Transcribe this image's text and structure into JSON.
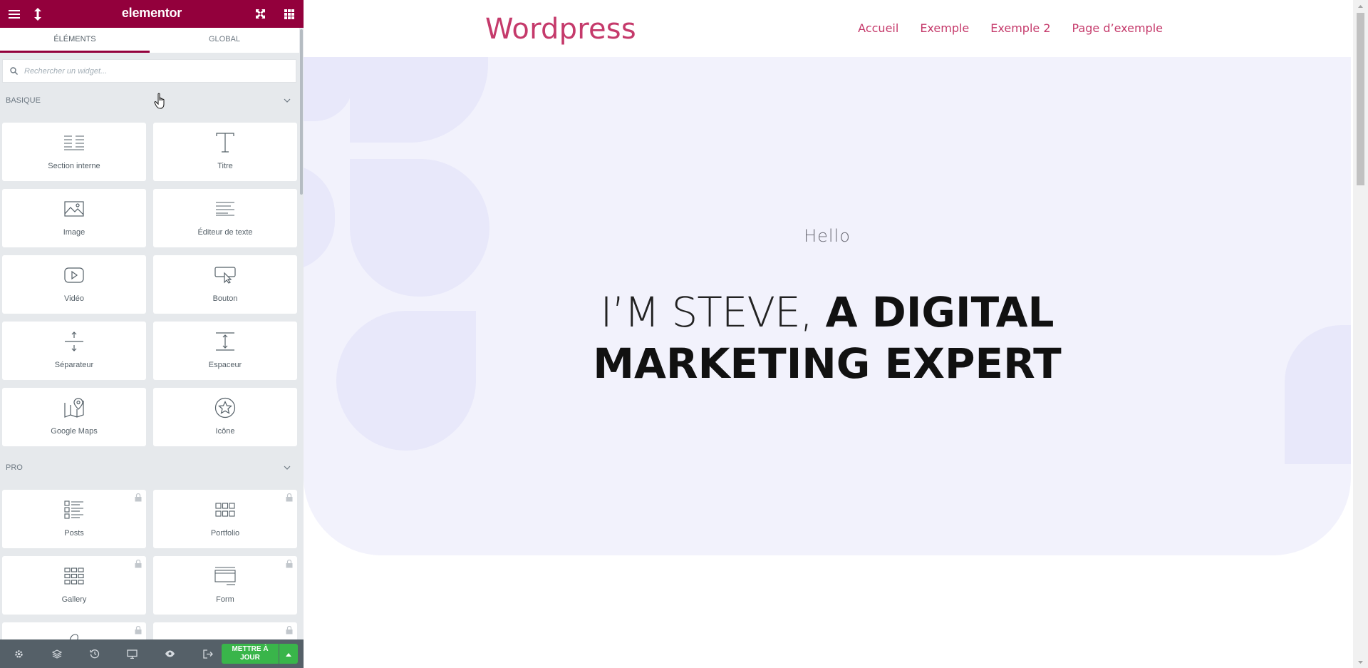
{
  "panel": {
    "logo": "elementor",
    "header_icons": [
      "hamburger-menu-icon",
      "resize-vertical-icon",
      "fullscreen-icon",
      "apps-grid-icon"
    ],
    "tabs": [
      {
        "label": "ÉLÉMENTS",
        "active": true
      },
      {
        "label": "GLOBAL",
        "active": false
      }
    ],
    "search": {
      "placeholder": "Rechercher un widget..."
    },
    "categories": [
      {
        "title": "BASIQUE",
        "widgets": [
          {
            "label": "Section interne",
            "icon": "inner-section-icon",
            "locked": false
          },
          {
            "label": "Titre",
            "icon": "heading-icon",
            "locked": false
          },
          {
            "label": "Image",
            "icon": "image-icon",
            "locked": false
          },
          {
            "label": "Éditeur de texte",
            "icon": "text-editor-icon",
            "locked": false
          },
          {
            "label": "Vidéo",
            "icon": "video-icon",
            "locked": false
          },
          {
            "label": "Bouton",
            "icon": "button-icon",
            "locked": false
          },
          {
            "label": "Séparateur",
            "icon": "divider-icon",
            "locked": false
          },
          {
            "label": "Espaceur",
            "icon": "spacer-icon",
            "locked": false
          },
          {
            "label": "Google Maps",
            "icon": "google-maps-icon",
            "locked": false
          },
          {
            "label": "Icône",
            "icon": "star-icon",
            "locked": false
          }
        ]
      },
      {
        "title": "PRO",
        "widgets": [
          {
            "label": "Posts",
            "icon": "posts-icon",
            "locked": true
          },
          {
            "label": "Portfolio",
            "icon": "portfolio-icon",
            "locked": true
          },
          {
            "label": "Gallery",
            "icon": "gallery-icon",
            "locked": true
          },
          {
            "label": "Form",
            "icon": "form-icon",
            "locked": true
          }
        ]
      }
    ],
    "footer": {
      "icons": [
        "settings-icon",
        "navigator-layers-icon",
        "history-icon",
        "responsive-mode-icon",
        "preview-eye-icon",
        "exit-icon"
      ],
      "update_label_line1": "METTRE À",
      "update_label_line2": "JOUR"
    }
  },
  "site": {
    "title": "Wordpress",
    "nav": [
      "Accueil",
      "Exemple",
      "Exemple 2",
      "Page d’exemple"
    ],
    "hero": {
      "kicker": "Hello",
      "headline_light": "I’M STEVE,",
      "headline_bold_1": "A DIGITAL",
      "headline_bold_2": "MARKETING EXPERT"
    }
  },
  "colors": {
    "elementor_header": "#93003c",
    "panel_bg": "#e6e9ec",
    "footer_bg": "#556068",
    "update_button": "#39b54a",
    "site_accent": "#c53a6b",
    "hero_bg": "#f2f2fc"
  }
}
